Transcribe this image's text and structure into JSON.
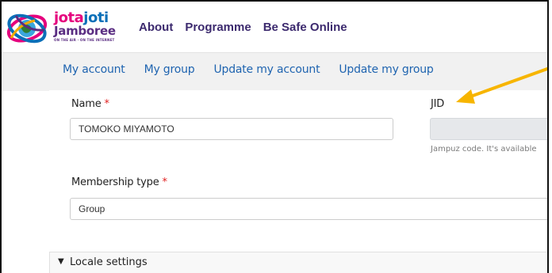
{
  "logo": {
    "line1_a": "jota",
    "line1_b": "joti",
    "line2": "Jamboree",
    "tagline": "ON THE AIR · ON THE INTERNET"
  },
  "topnav": {
    "items": [
      "About",
      "Programme",
      "Be Safe Online"
    ]
  },
  "subnav": {
    "items": [
      "My account",
      "My group",
      "Update my account",
      "Update my group"
    ]
  },
  "form": {
    "name_label": "Name",
    "name_value": "TOMOKO MIYAMOTO",
    "required_mark": "*",
    "jid_label": "JID",
    "jid_value": "",
    "jid_help": "Jampuz code. It's available",
    "membership_label": "Membership type",
    "membership_value": "Group"
  },
  "locale": {
    "label": "Locale settings",
    "toggle_glyph": "▼"
  },
  "colors": {
    "accent_blue": "#1f64b0",
    "nav_purple": "#3c2a6e",
    "arrow_yellow": "#f7b500",
    "required_red": "#e02020"
  }
}
